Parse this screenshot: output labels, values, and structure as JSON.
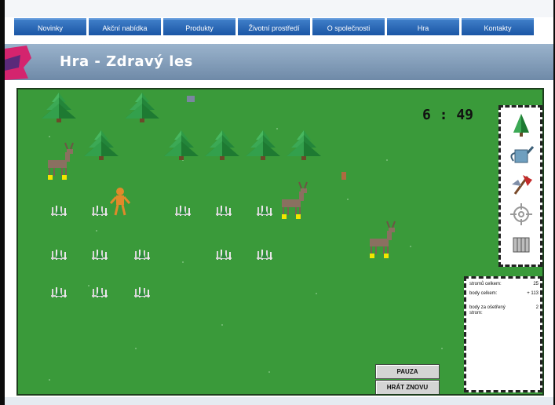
{
  "nav": {
    "tabs": [
      {
        "label": "Novinky"
      },
      {
        "label": "Akční nabídka"
      },
      {
        "label": "Produkty"
      },
      {
        "label": "Životní prostředí"
      },
      {
        "label": "O společnosti"
      },
      {
        "label": "Hra"
      },
      {
        "label": "Kontakty"
      }
    ],
    "active": "Hra"
  },
  "header": {
    "title": "Hra - Zdravý les"
  },
  "game": {
    "timer": "6 : 49",
    "tools": [
      {
        "icon": "tree-icon"
      },
      {
        "icon": "watering-can-icon"
      },
      {
        "icon": "axe-icon"
      },
      {
        "icon": "crosshair-icon"
      },
      {
        "icon": "fence-icon"
      }
    ],
    "stats": {
      "rows": [
        {
          "label": "stromů celkem:",
          "value": "25"
        },
        {
          "label": "body celkem:",
          "value": "+ 113"
        },
        {
          "label": "body za ošetřený strom:",
          "value": "2"
        }
      ]
    },
    "buttons": {
      "pause": "PAUZA",
      "restart": "HRÁT ZNOVU"
    }
  },
  "colors": {
    "grass": "#3a9a3a",
    "nav_blue": "#1b56a5",
    "title_bar": "#7f99b6",
    "tree_green": "#1e7a32",
    "deer": "#8a7060",
    "worker": "#e08a2a",
    "marker_yellow": "#f2e600"
  }
}
